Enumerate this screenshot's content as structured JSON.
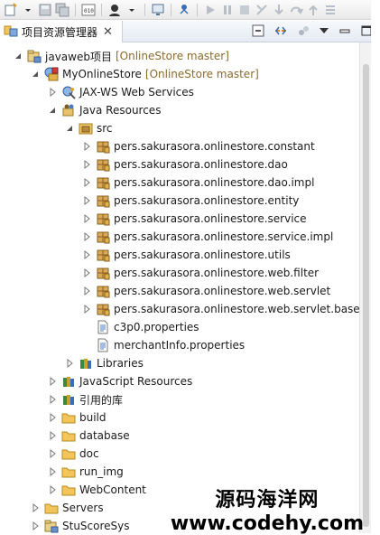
{
  "view": {
    "title": "项目资源管理器",
    "close_glyph": "✕"
  },
  "tree": [
    {
      "label": "javaweb项目",
      "extra": "[OnlineStore master]",
      "icon": "project-icon",
      "indent": 0,
      "twisty": "open"
    },
    {
      "label": "MyOnlineStore",
      "extra": "[OnlineStore master]",
      "icon": "web-project-icon",
      "indent": 1,
      "twisty": "open"
    },
    {
      "label": "JAX-WS Web Services",
      "icon": "webservice-icon",
      "indent": 2,
      "twisty": "closed"
    },
    {
      "label": "Java Resources",
      "icon": "java-resources-icon",
      "indent": 2,
      "twisty": "open"
    },
    {
      "label": "src",
      "icon": "source-folder-icon",
      "indent": 3,
      "twisty": "open"
    },
    {
      "label": "pers.sakurasora.onlinestore.constant",
      "icon": "package-icon",
      "indent": 4,
      "twisty": "closed"
    },
    {
      "label": "pers.sakurasora.onlinestore.dao",
      "icon": "package-icon",
      "indent": 4,
      "twisty": "closed"
    },
    {
      "label": "pers.sakurasora.onlinestore.dao.impl",
      "icon": "package-icon",
      "indent": 4,
      "twisty": "closed"
    },
    {
      "label": "pers.sakurasora.onlinestore.entity",
      "icon": "package-icon",
      "indent": 4,
      "twisty": "closed"
    },
    {
      "label": "pers.sakurasora.onlinestore.service",
      "icon": "package-icon",
      "indent": 4,
      "twisty": "closed"
    },
    {
      "label": "pers.sakurasora.onlinestore.service.impl",
      "icon": "package-icon",
      "indent": 4,
      "twisty": "closed"
    },
    {
      "label": "pers.sakurasora.onlinestore.utils",
      "icon": "package-icon",
      "indent": 4,
      "twisty": "closed"
    },
    {
      "label": "pers.sakurasora.onlinestore.web.filter",
      "icon": "package-icon",
      "indent": 4,
      "twisty": "closed"
    },
    {
      "label": "pers.sakurasora.onlinestore.web.servlet",
      "icon": "package-icon",
      "indent": 4,
      "twisty": "closed"
    },
    {
      "label": "pers.sakurasora.onlinestore.web.servlet.base",
      "icon": "package-icon",
      "indent": 4,
      "twisty": "closed"
    },
    {
      "label": "c3p0.properties",
      "icon": "properties-file-icon",
      "indent": 4,
      "twisty": "none"
    },
    {
      "label": "merchantInfo.properties",
      "icon": "properties-file-icon",
      "indent": 4,
      "twisty": "none"
    },
    {
      "label": "Libraries",
      "icon": "libraries-icon",
      "indent": 3,
      "twisty": "closed"
    },
    {
      "label": "JavaScript Resources",
      "icon": "javascript-resources-icon",
      "indent": 2,
      "twisty": "closed"
    },
    {
      "label": "引用的库",
      "icon": "libraries-icon",
      "indent": 2,
      "twisty": "closed"
    },
    {
      "label": "build",
      "icon": "folder-icon",
      "indent": 2,
      "twisty": "closed"
    },
    {
      "label": "database",
      "icon": "folder-icon",
      "indent": 2,
      "twisty": "closed"
    },
    {
      "label": "doc",
      "icon": "folder-icon",
      "indent": 2,
      "twisty": "closed"
    },
    {
      "label": "run_img",
      "icon": "folder-icon",
      "indent": 2,
      "twisty": "closed"
    },
    {
      "label": "WebContent",
      "icon": "folder-icon",
      "indent": 2,
      "twisty": "closed"
    },
    {
      "label": "Servers",
      "icon": "folder-icon",
      "indent": 1,
      "twisty": "closed"
    },
    {
      "label": "StuScoreSys",
      "icon": "project-icon",
      "indent": 1,
      "twisty": "closed"
    }
  ],
  "watermark": {
    "line1": "源码海洋网",
    "line2": "www.codehy.com"
  }
}
